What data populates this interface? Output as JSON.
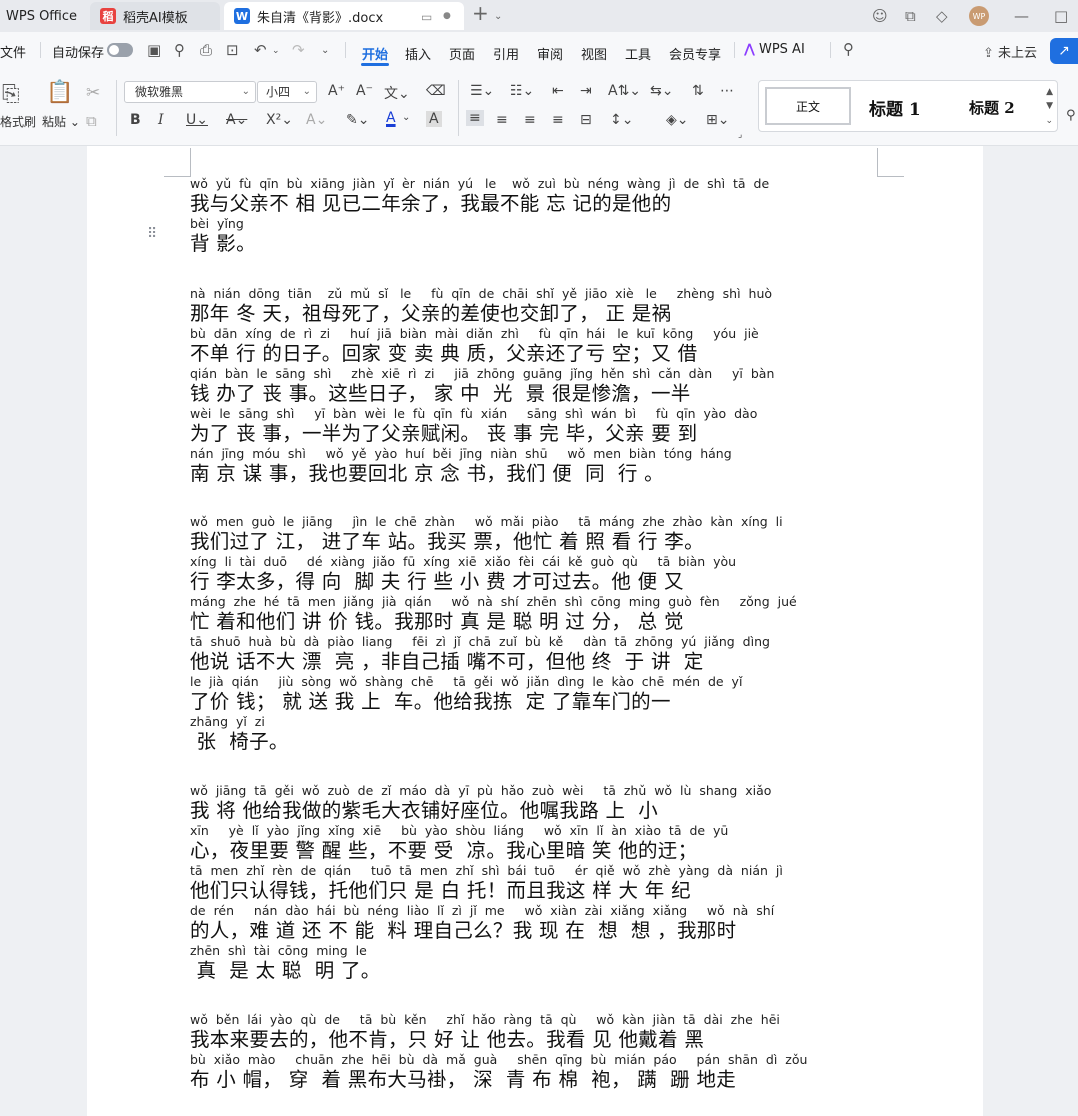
{
  "tabs": {
    "app": "WPS Office",
    "template": "稻壳AI模板",
    "document": "朱自清《背影》.docx",
    "new_tab": "+"
  },
  "menubar": {
    "file": "文件",
    "autosave": "自动保存",
    "items": [
      "开始",
      "插入",
      "页面",
      "引用",
      "审阅",
      "视图",
      "工具",
      "会员专享"
    ],
    "wps_ai": "WPS AI",
    "upload": "未上云"
  },
  "toolbar": {
    "format_painter": "格式刷",
    "paste": "粘贴",
    "font_name": "微软雅黑",
    "font_size": "小四"
  },
  "styles": {
    "normal": "正文",
    "heading1": "标题 1",
    "heading2": "标题 2"
  },
  "document": {
    "paragraphs": [
      {
        "lines": [
          {
            "pinyin": "wǒ  yǔ  fù  qīn  bù  xiāng  jiàn  yǐ  èr  nián  yú   le    wǒ  zuì  bù  néng  wàng  jì  de  shì  tā  de",
            "text": "我与父亲不 相 见已二年余了，我最不能 忘 记的是他的"
          },
          {
            "pinyin": "bèi  yǐng",
            "text": "背 影。"
          }
        ]
      },
      {
        "lines": [
          {
            "pinyin": "nà  nián  dōng  tiān    zǔ  mǔ  sǐ   le     fù  qīn  de  chāi  shǐ  yě  jiāo  xiè   le     zhèng  shì  huò",
            "text": "那年 冬 天，祖母死了，父亲的差使也交卸了， 正 是祸"
          },
          {
            "pinyin": "bù  dān  xíng  de  rì  zi     huí  jiā  biàn  mài  diǎn  zhì     fù  qīn  hái   le  kuī  kōng     yóu  jiè",
            "text": "不单 行 的日子。回家 变 卖 典 质，父亲还了亏 空；又 借"
          },
          {
            "pinyin": "qián  bàn  le  sāng  shì     zhè  xiē  rì  zi     jiā  zhōng  guāng  jǐng  hěn  shì  cǎn  dàn     yī  bàn",
            "text": "钱 办了 丧 事。这些日子， 家 中  光  景 很是惨澹，一半"
          },
          {
            "pinyin": "wèi  le  sāng  shì     yī  bàn  wèi  le  fù  qīn  fù  xián     sāng  shì  wán  bì     fù  qīn  yào  dào",
            "text": "为了 丧 事，一半为了父亲赋闲。 丧 事 完 毕，父亲 要 到"
          },
          {
            "pinyin": "nán  jīng  móu  shì     wǒ  yě  yào  huí  běi  jīng  niàn  shū     wǒ  men  biàn  tóng  háng",
            "text": "南 京 谋 事，我也要回北 京 念 书，我们 便  同  行 。"
          }
        ]
      },
      {
        "lines": [
          {
            "pinyin": "wǒ  men  guò  le  jiāng     jìn  le  chē  zhàn     wǒ  mǎi  piào     tā  máng  zhe  zhào  kàn  xíng  li",
            "text": "我们过了 江， 进了车 站。我买 票，他忙 着 照 看 行 李。"
          },
          {
            "pinyin": "xíng  li  tài  duō     dé  xiàng  jiǎo  fū  xíng  xiē  xiǎo  fèi  cái  kě  guò  qù     tā  biàn  yòu",
            "text": "行 李太多，得 向  脚 夫 行 些 小 费 才可过去。他 便 又"
          },
          {
            "pinyin": "máng  zhe  hé  tā  men  jiǎng  jià  qián     wǒ  nà  shí  zhēn  shì  cōng  ming  guò  fèn     zǒng  jué",
            "text": "忙 着和他们 讲 价 钱。我那时 真 是 聪 明 过 分， 总 觉"
          },
          {
            "pinyin": "tā  shuō  huà  bù  dà  piào  liang     fēi  zì  jǐ  chā  zuǐ  bù  kě     dàn  tā  zhōng  yú  jiǎng  dìng",
            "text": "他说 话不大 漂  亮 ，非自己插 嘴不可，但他 终  于 讲  定"
          },
          {
            "pinyin": "le  jià  qián     jiù  sòng  wǒ  shàng  chē     tā  gěi  wǒ  jiǎn  dìng  le  kào  chē  mén  de  yǐ",
            "text": "了价 钱； 就 送 我 上  车。他给我拣  定 了靠车门的一"
          },
          {
            "pinyin": "zhāng  yǐ  zi",
            "text": " 张  椅子。"
          }
        ]
      },
      {
        "lines": [
          {
            "pinyin": "wǒ  jiāng  tā  gěi  wǒ  zuò  de  zǐ  máo  dà  yī  pù  hǎo  zuò  wèi     tā  zhǔ  wǒ  lù  shang  xiǎo",
            "text": "我 将 他给我做的紫毛大衣铺好座位。他嘱我路 上  小"
          },
          {
            "pinyin": "xīn     yè  lǐ  yào  jǐng  xǐng  xiē     bù  yào  shòu  liáng     wǒ  xīn  lǐ  àn  xiào  tā  de  yū",
            "text": "心，夜里要 警 醒 些，不要 受  凉。我心里暗 笑 他的迂；"
          },
          {
            "pinyin": "tā  men  zhǐ  rèn  de  qián     tuō  tā  men  zhǐ  shì  bái  tuō     ér  qiě  wǒ  zhè  yàng  dà  nián  jì",
            "text": "他们只认得钱，托他们只 是 白 托！而且我这 样 大 年 纪"
          },
          {
            "pinyin": "de  rén     nán  dào  hái  bù  néng  liào  lǐ  zì  jǐ  me     wǒ  xiàn  zài  xiǎng  xiǎng     wǒ  nà  shí",
            "text": "的人，难 道 还 不 能  料 理自己么？我 现 在  想  想 ，我那时"
          },
          {
            "pinyin": "zhēn  shì  tài  cōng  ming  le",
            "text": " 真  是 太 聪  明 了。"
          }
        ]
      },
      {
        "lines": [
          {
            "pinyin": "wǒ  běn  lái  yào  qù  de     tā  bù  kěn     zhǐ  hǎo  ràng  tā  qù     wǒ  kàn  jiàn  tā  dài  zhe  hēi",
            "text": "我本来要去的，他不肯，只 好 让 他去。我看 见 他戴着 黑"
          },
          {
            "pinyin": "bù  xiǎo  mào     chuān  zhe  hēi  bù  dà  mǎ  guà     shēn  qīng  bù  mián  páo     pán  shān  dì  zǒu",
            "text": "布 小 帽， 穿  着 黑布大马褂， 深  青 布 棉  袍， 蹒  跚 地走"
          }
        ]
      }
    ]
  }
}
